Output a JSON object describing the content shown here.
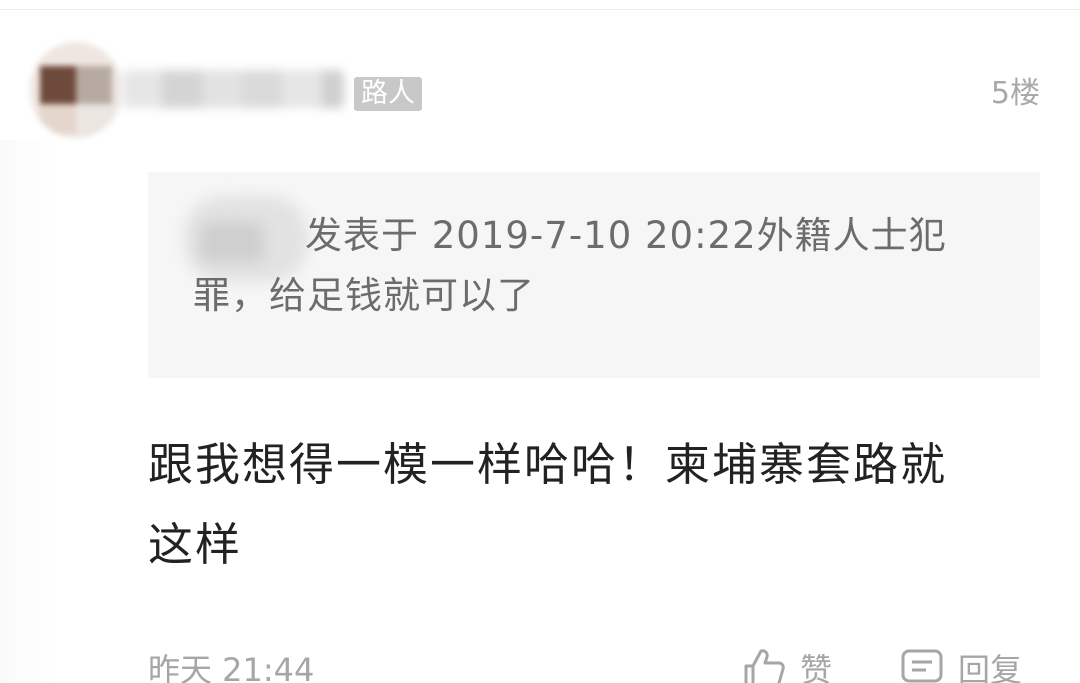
{
  "comment": {
    "user_badge": "路人",
    "floor": "5楼",
    "quote": {
      "text": "发表于 2019-7-10 20:22外籍人士犯罪，给足钱就可以了"
    },
    "body": "跟我想得一模一样哈哈！柬埔寨套路就这样",
    "time": "昨天 21:44",
    "actions": {
      "like_label": "赞",
      "reply_label": "回复"
    }
  },
  "colors": {
    "badge_bg": "#c8c8c8",
    "quote_bg": "#f6f6f6",
    "muted_text": "#a6a6a6",
    "body_text": "#222222"
  },
  "icons": {
    "like": "thumbs-up-icon",
    "reply": "comment-icon"
  }
}
